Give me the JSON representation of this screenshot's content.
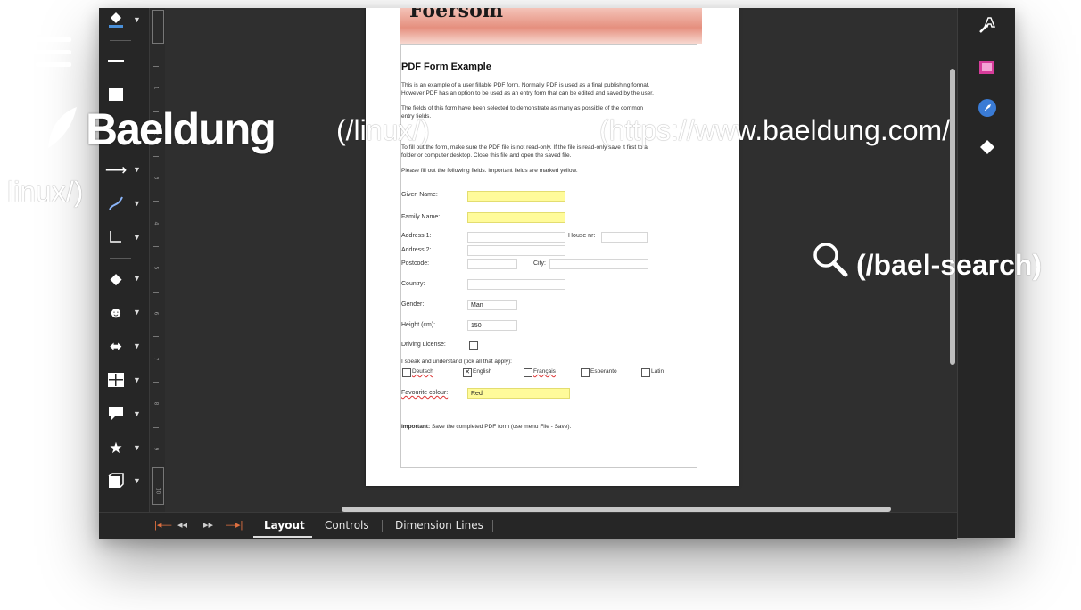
{
  "site": {
    "logo_text": "Baeldung",
    "linux_link": "(/linux/)",
    "url_link_line1": "(https://www.baeldung.com/",
    "url_link_line2": "linux/)",
    "search_link": "(/bael-search)",
    "icons": [
      "menu-icon",
      "baeldung-leaf-icon",
      "search-icon"
    ]
  },
  "document": {
    "banner_text": "Foersom",
    "form_title": "PDF Form Example",
    "intro_line1": "This is an example of a user fillable PDF form. Normally PDF is used as a final publishing format.",
    "intro_line2": "However PDF has an option to be used as an entry form that can be edited and saved by the user.",
    "fields_line1": "The fields of this form have been selected to demonstrate as many as possible of the common",
    "fields_line2": "entry fields.",
    "readonly_line1": "To fill out the form, make sure the PDF file is not read-only. If the file is read-only save it first to a",
    "readonly_line2": "folder or computer desktop. Close this file and open the saved file.",
    "fill_instruction": "Please fill out the following fields. Important fields are marked yellow.",
    "labels": {
      "given_name": "Given Name:",
      "family_name": "Family Name:",
      "address1": "Address 1:",
      "house_nr": "House nr:",
      "address2": "Address 2:",
      "postcode": "Postcode:",
      "city": "City:",
      "country": "Country:",
      "gender": "Gender:",
      "height": "Height (cm):",
      "driving_license": "Driving License:",
      "languages_prompt": "I speak and understand (tick all that apply):",
      "favourite_colour": "Favourite colour:"
    },
    "values": {
      "gender": "Man",
      "height": "150",
      "favourite_colour": "Red"
    },
    "languages": [
      {
        "name": "Deutsch",
        "checked": false
      },
      {
        "name": "English",
        "checked": true
      },
      {
        "name": "Français",
        "checked": false
      },
      {
        "name": "Esperanto",
        "checked": false
      },
      {
        "name": "Latin",
        "checked": false
      }
    ],
    "checked_mark": "✕",
    "important_label": "Important:",
    "important_text": "Save the completed PDF form (use menu File - Save)."
  },
  "bottom_bar": {
    "tabs": [
      "Layout",
      "Controls",
      "Dimension Lines"
    ],
    "active_tab": "Layout",
    "nav_first": "|◂—",
    "nav_prev": "◂◂",
    "nav_next": "▸▸",
    "nav_last": "—▸|"
  },
  "ruler": {
    "numbers": [
      "1",
      "2",
      "3",
      "4",
      "5",
      "6",
      "7",
      "8",
      "9",
      "10"
    ]
  },
  "toolbar": {
    "tools": [
      "fill-color-icon",
      "line-icon",
      "rectangle-icon",
      "arrow-line-icon",
      "curve-icon",
      "connector-icon",
      "basic-shapes-icon",
      "smiley-icon",
      "block-arrows-icon",
      "flowchart-icon",
      "callout-icon",
      "star-icon",
      "3d-object-icon"
    ]
  },
  "colors": {
    "window_bg": "#2b2b2b",
    "panel_bg": "#262626",
    "required_field": "#fffb9a",
    "banner": "#e58f7e",
    "nav_accent": "#e07040"
  }
}
